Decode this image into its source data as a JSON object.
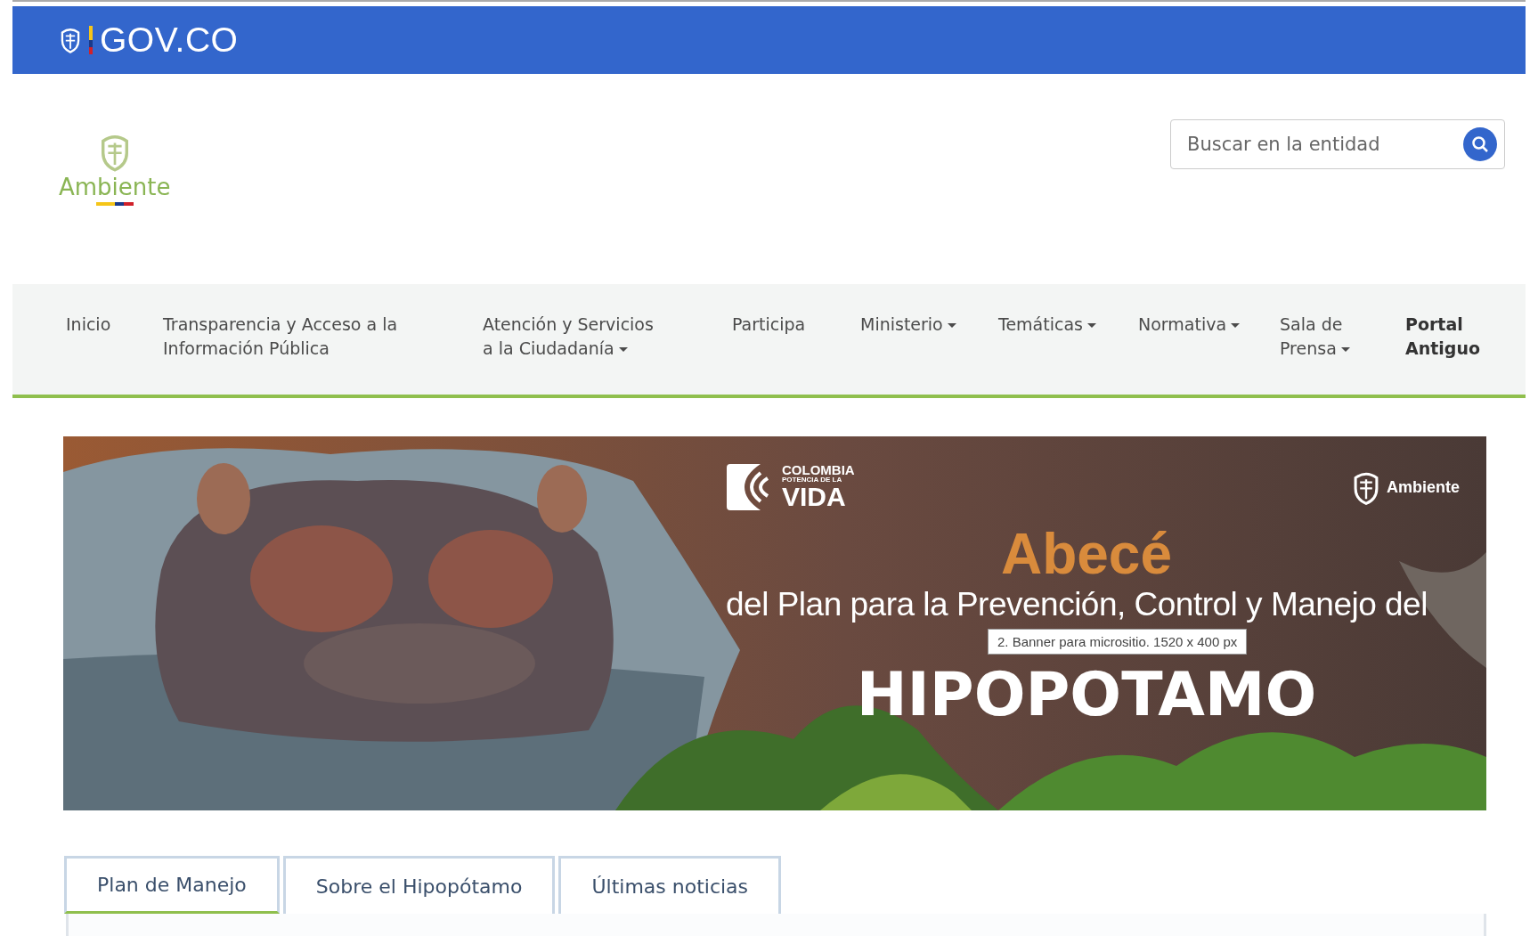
{
  "gov_bar": {
    "logo_text": "GOV.CO"
  },
  "header": {
    "logo_text": "Ambiente",
    "search": {
      "placeholder": "Buscar en la entidad"
    }
  },
  "nav": [
    {
      "label": "Inicio",
      "dropdown": false,
      "bold": false
    },
    {
      "label": "Transparencia y Acceso a la\nInformación Pública",
      "dropdown": false,
      "bold": false
    },
    {
      "label": "Atención y Servicios\na la Ciudadanía",
      "dropdown": true,
      "bold": false
    },
    {
      "label": "Participa",
      "dropdown": false,
      "bold": false
    },
    {
      "label": "Ministerio",
      "dropdown": true,
      "bold": false
    },
    {
      "label": "Temáticas",
      "dropdown": true,
      "bold": false
    },
    {
      "label": "Normativa",
      "dropdown": true,
      "bold": false
    },
    {
      "label": "Sala de\nPrensa",
      "dropdown": true,
      "bold": false
    },
    {
      "label": "Portal\nAntiguo",
      "dropdown": false,
      "bold": true
    }
  ],
  "banner": {
    "kind": "picture",
    "brand": {
      "line_1": "COLOMBIA",
      "line_2": "POTENCIA DE LA",
      "line_3": "VIDA"
    },
    "ministry": "Ambiente",
    "title": "Abecé",
    "subtitle": "del Plan para la Prevención, Control y Manejo del",
    "headline": "HIPOPOTAMO",
    "tooltip": "2. Banner para micrositio. 1520 x 400 px"
  },
  "tabs": [
    {
      "label": "Plan de Manejo",
      "selected": true
    },
    {
      "label": "Sobre el Hipopótamo",
      "selected": false
    },
    {
      "label": "Últimas noticias",
      "selected": false
    }
  ]
}
